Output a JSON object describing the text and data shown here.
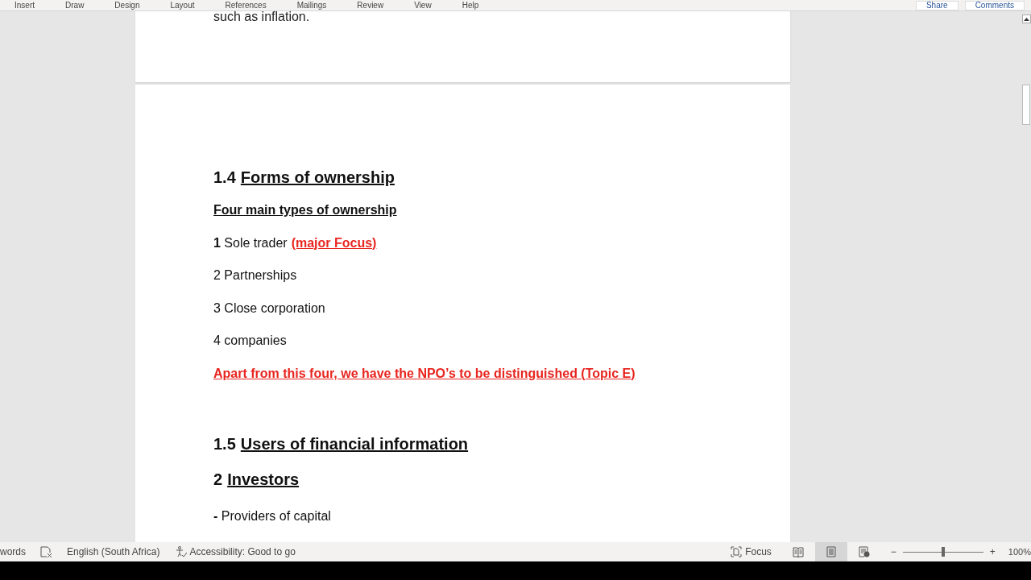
{
  "ribbon": {
    "tabs": [
      "Insert",
      "Draw",
      "Design",
      "Layout",
      "References",
      "Mailings",
      "Review",
      "View",
      "Help"
    ],
    "buttons": [
      "Share",
      "Comments"
    ]
  },
  "document": {
    "page_tail": "such as inflation.",
    "sections": [
      {
        "number": "1.4",
        "title": "Forms of ownership",
        "blocks": [
          {
            "kind": "subheading",
            "text": "Four main types of ownership"
          },
          {
            "kind": "item",
            "text": "**1** Sole trader",
            "note": "(major Focus)"
          },
          {
            "kind": "item",
            "text": "2 Partnerships"
          },
          {
            "kind": "item",
            "text": "3 Close corporation"
          },
          {
            "kind": "item",
            "text": "4 companies"
          },
          {
            "kind": "note",
            "text": "Apart from this four, we have the NPO’s to be distinguished (Topic E)"
          }
        ]
      },
      {
        "number": "1.5",
        "title": "Users of financial information",
        "blocks": [
          {
            "kind": "heading",
            "number": "2",
            "text": "Investors"
          },
          {
            "kind": "bullet",
            "text": "**-** Providers of capital"
          }
        ]
      }
    ]
  },
  "status_bar": {
    "words": "words",
    "language": "English (South Africa)",
    "accessibility": "Accessibility: Good to go",
    "focus": "Focus",
    "views": [
      {
        "kind": "read",
        "selected": false
      },
      {
        "kind": "print",
        "selected": true
      },
      {
        "kind": "web",
        "selected": false
      }
    ],
    "zoom": {
      "minus": "−",
      "plus": "+",
      "level": 0.5,
      "reading": "100%"
    }
  }
}
